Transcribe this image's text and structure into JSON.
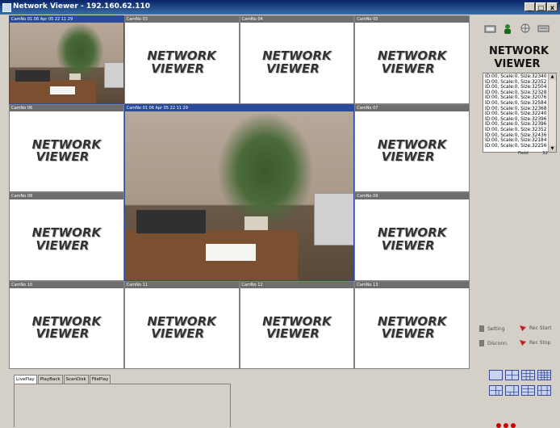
{
  "window": {
    "title": "Network Viewer - 192.160.62.110",
    "min_label": "_",
    "max_label": "□",
    "close_label": "x"
  },
  "logo": {
    "line1": "NETWORK",
    "line2": "VIEWER"
  },
  "cameras": [
    {
      "id": "c1",
      "label": "CamNo 01 06 Apr 05 22 11 29",
      "feed": true,
      "active": true
    },
    {
      "id": "c2",
      "label": "CamNo 03",
      "feed": false
    },
    {
      "id": "c3",
      "label": "CamNo 04",
      "feed": false
    },
    {
      "id": "c4",
      "label": "CamNo 05",
      "feed": false
    },
    {
      "id": "c5",
      "label": "CamNo 06",
      "feed": false
    },
    {
      "id": "big",
      "label": "CamNo 01 06 Apr 05 22 11 29",
      "feed": true,
      "active": true
    },
    {
      "id": "c7",
      "label": "CamNo 07",
      "feed": false
    },
    {
      "id": "c8",
      "label": "CamNo 08",
      "feed": false
    },
    {
      "id": "c9",
      "label": "CamNo 09",
      "feed": false
    },
    {
      "id": "c10",
      "label": "CamNo 10",
      "feed": false
    },
    {
      "id": "c11",
      "label": "CamNo 11",
      "feed": false
    },
    {
      "id": "c12",
      "label": "CamNo 12",
      "feed": false
    },
    {
      "id": "c13",
      "label": "CamNo 13",
      "feed": false
    }
  ],
  "panel": {
    "brand_line1": "NETWORK",
    "brand_line2": "VIEWER",
    "log": [
      "ID:00, Scale:0, Size:32340",
      "ID:00, Scale:0, Size:32352",
      "ID:00, Scale:0, Size:32504",
      "ID:00, Scale:0, Size:32328",
      "ID:00, Scale:0, Size:32076",
      "ID:00, Scale:0, Size:32584",
      "ID:00, Scale:0, Size:32368",
      "ID:00, Scale:0, Size:32240",
      "ID:00, Scale:0, Size:32396",
      "ID:00, Scale:0, Size:32396",
      "ID:00, Scale:0, Size:32352",
      "ID:00, Scale:0, Size:32436",
      "ID:00, Scale:0, Size:32184",
      "ID:00, Scale:0, Size:32256"
    ],
    "field_label": "Field",
    "field_value": "32",
    "setting_label": "Setting",
    "disconn_label": "Disconn.",
    "rec_start_label": "Rec Start",
    "rec_stop_label": "Rec Stop"
  },
  "tabs": [
    "LivePlay",
    "PlayBack",
    "ScanDisk",
    "FilePlay"
  ],
  "colors": {
    "title_bar": "#0a246a",
    "active_cam": "#2a4a9a",
    "rec": "#c02020"
  }
}
